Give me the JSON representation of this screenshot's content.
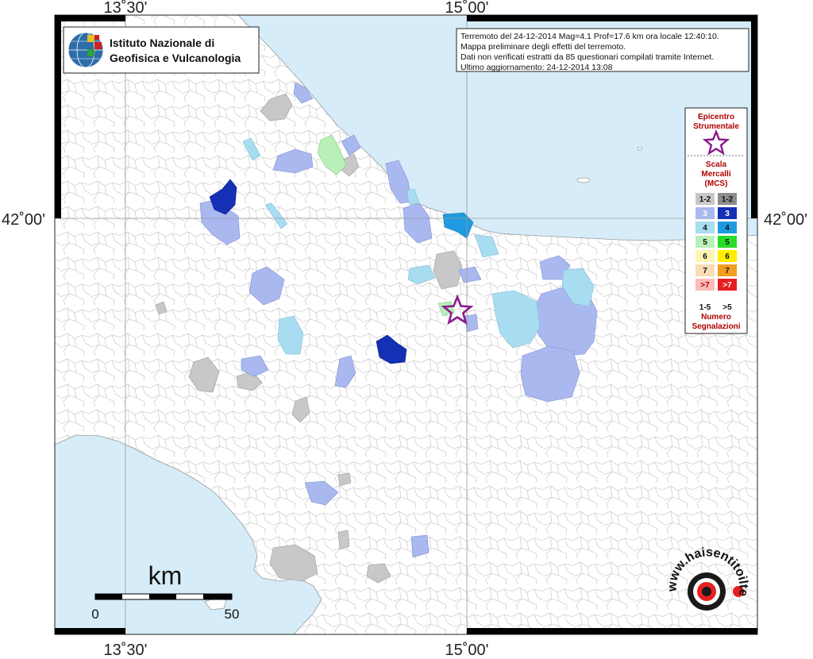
{
  "coordinates": {
    "top_left_lon": "13˚30'",
    "top_right_lon": "15˚00'",
    "bottom_left_lon": "13˚30'",
    "bottom_right_lon": "15˚00'",
    "left_lat": "42˚00'",
    "right_lat": "42˚00'"
  },
  "institution": {
    "line1": "Istituto Nazionale di",
    "line2": "Geofisica e Vulcanologia"
  },
  "info": {
    "line1": "Terremoto del 24-12-2014 Mag=4.1 Prof=17.6 km ora locale 12:40:10.",
    "line2": "Mappa preliminare degli effetti del terremoto.",
    "line3": "Dati non verificati estratti da 85 questionari compilati tramite Internet.",
    "line4": "Ultimo aggiornamento: 24-12-2014 13:08"
  },
  "legend": {
    "epicenter_line1": "Epicentro",
    "epicenter_line2": "Strumentale",
    "scale_line1": "Scala",
    "scale_line2": "Mercalli",
    "scale_line3": "(MCS)",
    "rows": [
      {
        "label_left": "1-2",
        "label_right": "1-2",
        "color_left": "#c8c8c8",
        "color_right": "#8c8c8c",
        "text_left": "#111",
        "text_right": "#111"
      },
      {
        "label_left": "3",
        "label_right": "3",
        "color_left": "#aab8f0",
        "color_right": "#1430b4",
        "text_left": "#ffffff",
        "text_right": "#ffffff"
      },
      {
        "label_left": "4",
        "label_right": "4",
        "color_left": "#a8dcf0",
        "color_right": "#1e9be0",
        "text_left": "#111",
        "text_right": "#111"
      },
      {
        "label_left": "5",
        "label_right": "5",
        "color_left": "#b8f0b8",
        "color_right": "#28dc28",
        "text_left": "#111",
        "text_right": "#111"
      },
      {
        "label_left": "6",
        "label_right": "6",
        "color_left": "#fff4b4",
        "color_right": "#ffee00",
        "text_left": "#111",
        "text_right": "#111"
      },
      {
        "label_left": "7",
        "label_right": "7",
        "color_left": "#fcdcb4",
        "color_right": "#f0a01e",
        "text_left": "#111",
        "text_right": "#111"
      },
      {
        "label_left": ">7",
        "label_right": ">7",
        "color_left": "#fcbcbc",
        "color_right": "#e61e1e",
        "text_left": "#b00000",
        "text_right": "#ffffff"
      }
    ],
    "count_left": "1-5",
    "count_right": ">5",
    "count_line1": "Numero",
    "count_line2": "Segnalazioni"
  },
  "scale_bar": {
    "unit": "km",
    "start": "0",
    "end": "50"
  },
  "brand": {
    "text": "www.haisentitoilterremoto.it"
  },
  "colors": {
    "sea": "#d6ecf8",
    "land": "#ffffff",
    "municipal_border": "#cfcfcf",
    "epicenter_star": "#8b1a8b",
    "legend_red": "#b00000"
  }
}
